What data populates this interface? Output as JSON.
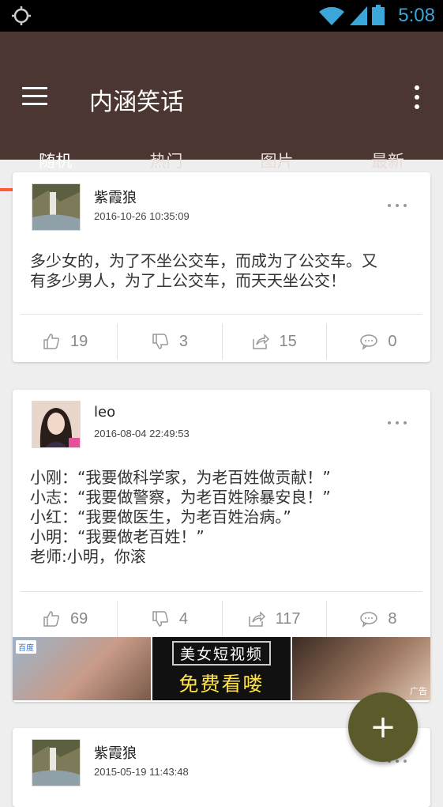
{
  "status_bar": {
    "time": "5:08",
    "colors": {
      "accent": "#3aa7d8"
    }
  },
  "app_bar": {
    "title": "内涵笑话",
    "background": "#4b3631"
  },
  "tabs": [
    {
      "label": "随机",
      "active": true
    },
    {
      "label": "热门",
      "active": false
    },
    {
      "label": "图片",
      "active": false
    },
    {
      "label": "最新",
      "active": false
    }
  ],
  "posts": [
    {
      "username": "紫霞狼",
      "time": "2016-10-26 10:35:09",
      "content": [
        "多少女的，为了不坐公交车，而成为了公交车。又",
        "有多少男人，为了上公交车，而天天坐公交！"
      ],
      "likes": "19",
      "dislikes": "3",
      "shares": "15",
      "comments": "0"
    },
    {
      "username": "leo",
      "time": "2016-08-04 22:49:53",
      "content": [
        "小刚：“我要做科学家，为老百姓做贡献！”",
        "小志：“我要做警察，为老百姓除暴安良！”",
        "小红：“我要做医生，为老百姓治病。”",
        "小明：“我要做老百姓！”",
        "老师:小明，你滚"
      ],
      "likes": "69",
      "dislikes": "4",
      "shares": "117",
      "comments": "8"
    },
    {
      "username": "紫霞狼",
      "time": "2015-05-19 11:43:48"
    }
  ],
  "ad": {
    "badge": "百度",
    "line1": "美女短视频",
    "line2": "免费看喽",
    "tag": "广告"
  },
  "fab": {
    "icon": "plus-icon",
    "label": "+"
  }
}
